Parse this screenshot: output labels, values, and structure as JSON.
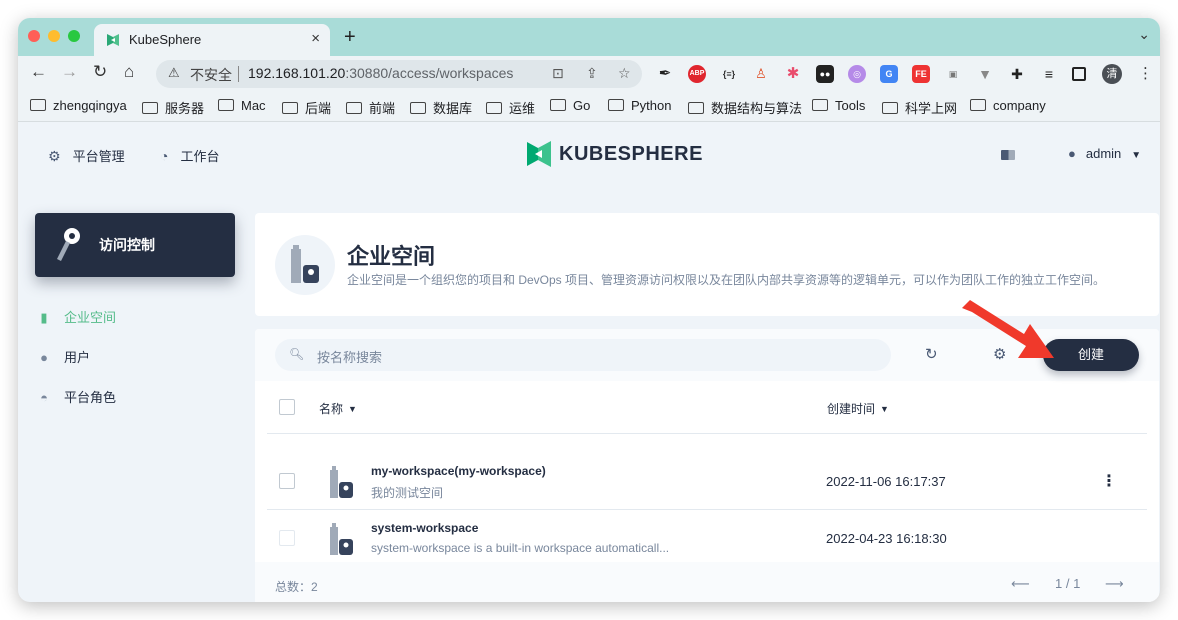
{
  "browser": {
    "tab_title": "KubeSphere",
    "tab_close": "×",
    "new_tab": "+",
    "insecure_label": "不安全",
    "url_host": "192.168.101.20",
    "url_rest": ":30880/access/workspaces",
    "profile_initial": "清",
    "bookmarks": [
      "zhengqingya",
      "服务器",
      "Mac",
      "后端",
      "前端",
      "数据库",
      "运维",
      "Go",
      "Python",
      "数据结构与算法",
      "Tools",
      "科学上网",
      "company"
    ]
  },
  "header": {
    "platform_label": "平台管理",
    "workbench_label": "工作台",
    "logo_text": "KUBESPHERE",
    "user_name": "admin"
  },
  "sidebar": {
    "card_title": "访问控制",
    "items": [
      {
        "label": "企业空间"
      },
      {
        "label": "用户"
      },
      {
        "label": "平台角色"
      }
    ]
  },
  "banner": {
    "title": "企业空间",
    "description": "企业空间是一个组织您的项目和 DevOps 项目、管理资源访问权限以及在团队内部共享资源等的逻辑单元，可以作为团队工作的独立工作空间。"
  },
  "toolbar": {
    "search_placeholder": "按名称搜索",
    "create_label": "创建"
  },
  "table": {
    "columns": [
      "名称",
      "创建时间"
    ],
    "rows": [
      {
        "name": "my-workspace(my-workspace)",
        "desc": "我的测试空间",
        "created": "2022-11-06 16:17:37"
      },
      {
        "name": "system-workspace",
        "desc": "system-workspace is a built-in workspace automaticall...",
        "created": "2022-04-23 16:18:30"
      }
    ]
  },
  "footer": {
    "total": "总数：2",
    "page": "1 / 1"
  },
  "colors": {
    "accent_green": "#55bc8a",
    "dark": "#242e42",
    "arrow_red": "#f0392b"
  }
}
